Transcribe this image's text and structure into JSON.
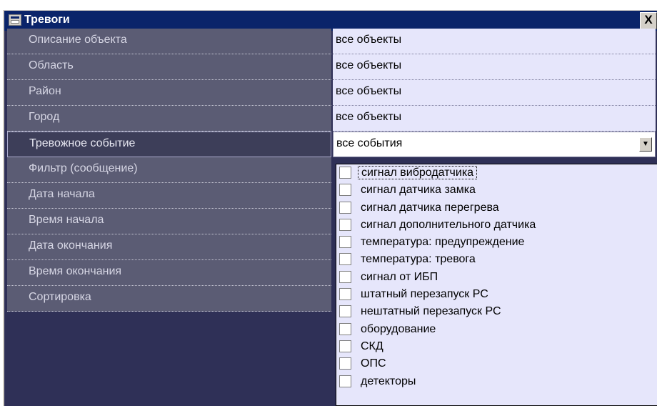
{
  "window": {
    "title": "Тревоги",
    "close_label": "X"
  },
  "filters": [
    {
      "label": "Описание объекта",
      "value": "все объекты"
    },
    {
      "label": "Область",
      "value": "все объекты"
    },
    {
      "label": "Район",
      "value": "все объекты"
    },
    {
      "label": "Город",
      "value": "все объекты"
    },
    {
      "label": "Тревожное событие",
      "value": "все события"
    },
    {
      "label": "Фильтр (сообщение)"
    },
    {
      "label": "Дата начала"
    },
    {
      "label": "Время начала"
    },
    {
      "label": "Дата окончания"
    },
    {
      "label": "Время окончания"
    },
    {
      "label": "Сортировка"
    }
  ],
  "dropdown": {
    "options": [
      "сигнал вибродатчика",
      "сигнал датчика замка",
      "сигнал датчика перегрева",
      "сигнал дополнительного датчика",
      "температура: предупреждение",
      "температура: тревога",
      "сигнал от ИБП",
      "штатный перезапуск РС",
      "нештатный перезапуск РС",
      "оборудование",
      "СКД",
      "ОПС",
      "детекторы"
    ]
  },
  "colors": {
    "titlebar": "#0a246a",
    "background": "#2f3057",
    "label_row": "#5b5c74",
    "value_row": "#e6e6fb"
  }
}
